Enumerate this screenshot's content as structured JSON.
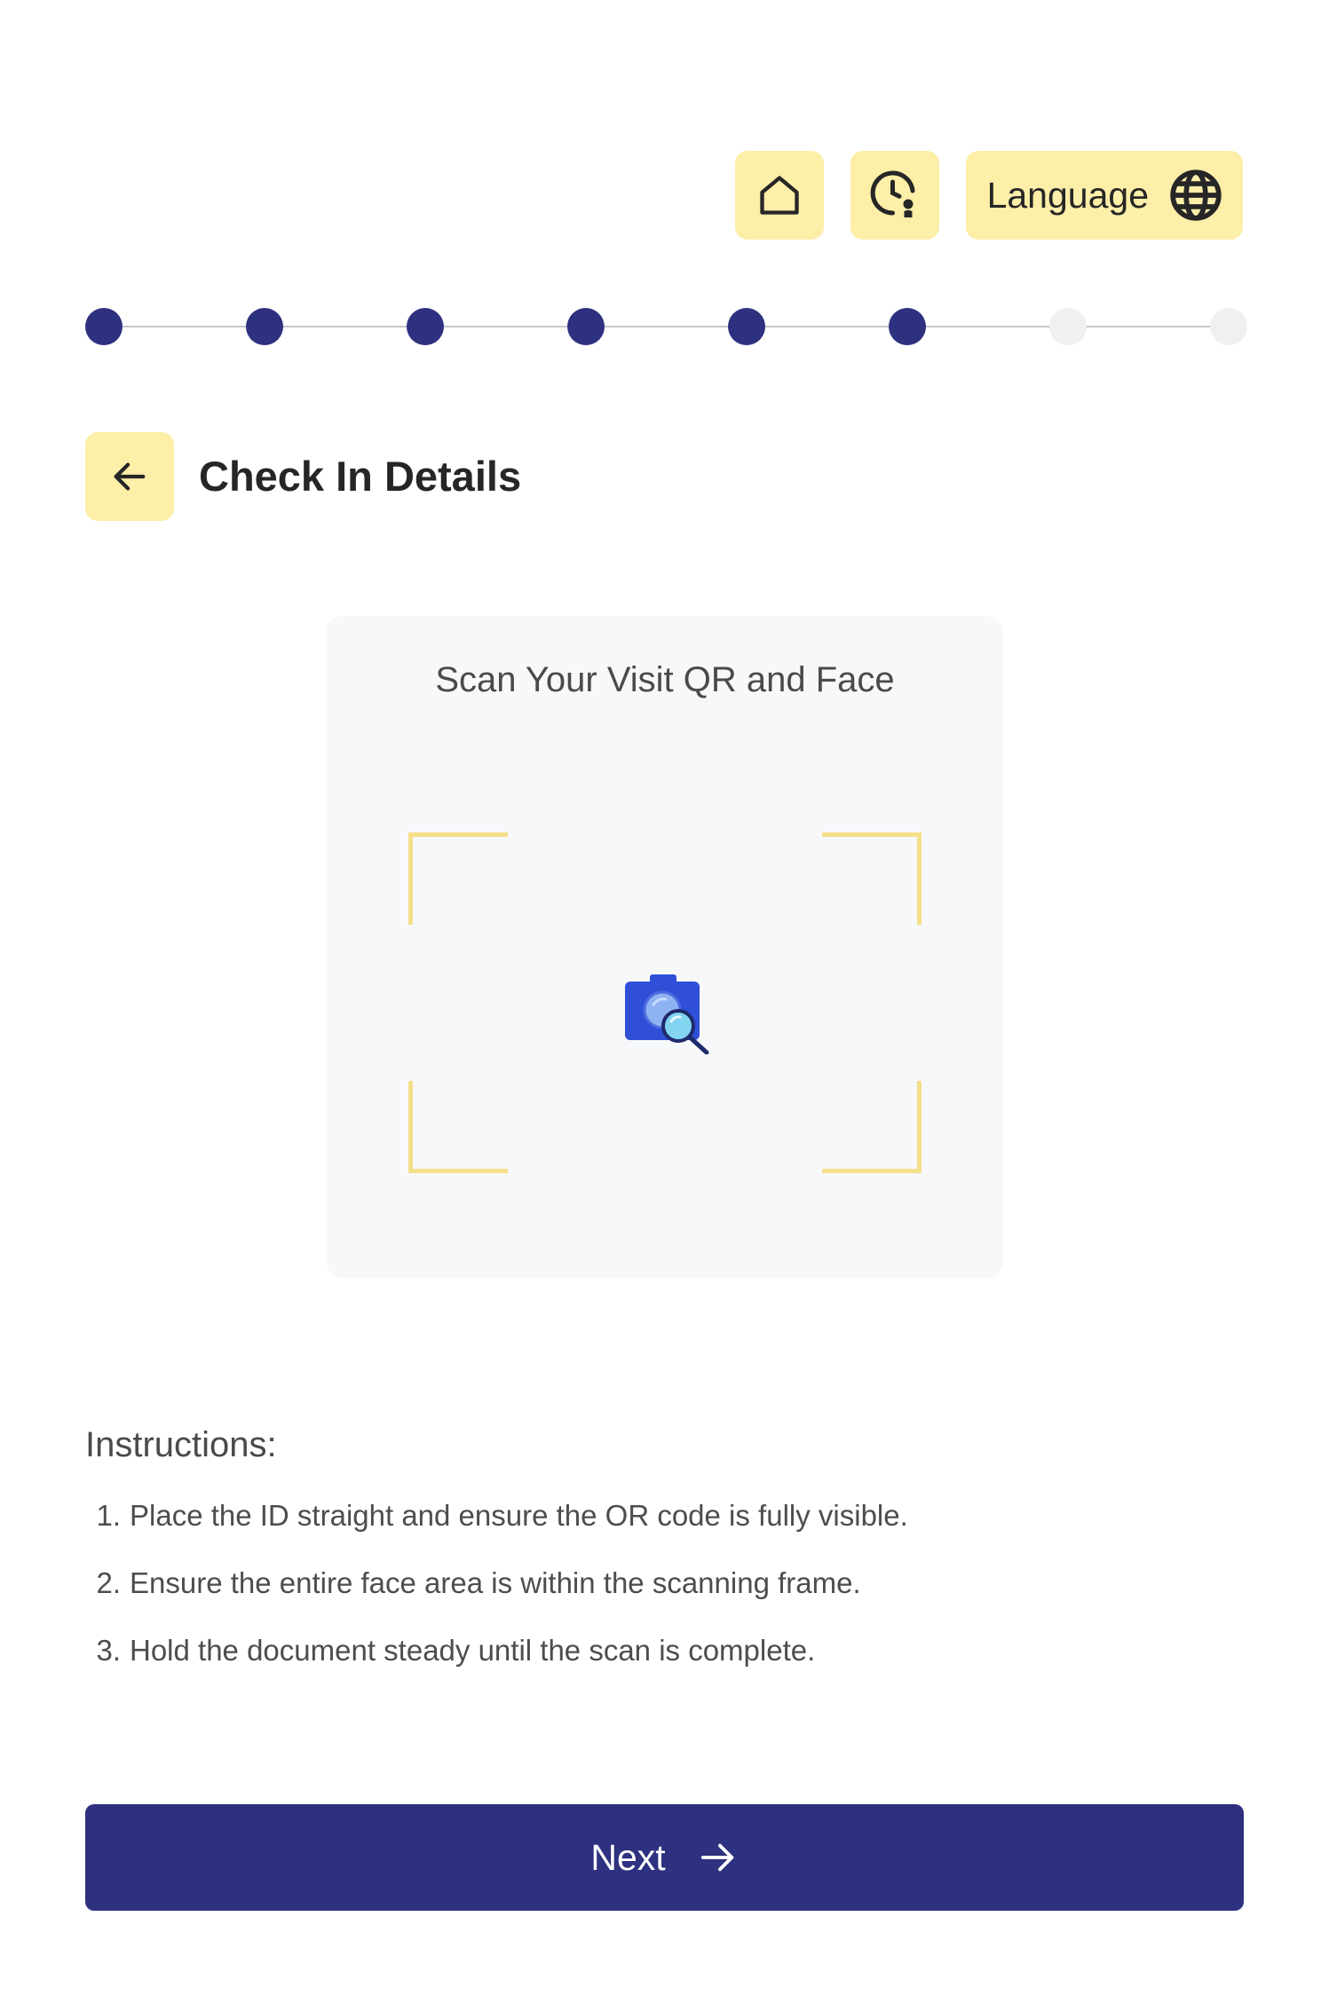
{
  "header": {
    "language_label": "Language"
  },
  "stepper": {
    "total_steps": 8,
    "completed_steps": 6
  },
  "page": {
    "title": "Check In Details"
  },
  "scan": {
    "title": "Scan Your Visit QR and Face"
  },
  "instructions": {
    "title": "Instructions:",
    "items": [
      {
        "num": "1.",
        "text": "Place the ID straight and ensure the OR code is fully visible."
      },
      {
        "num": "2.",
        "text": "Ensure the entire face area is within the scanning frame."
      },
      {
        "num": "3.",
        "text": "Hold the document steady until the scan is complete."
      }
    ]
  },
  "footer": {
    "next_label": "Next"
  },
  "icons": {
    "home": "home-icon",
    "history": "clock-badge-icon",
    "language": "globe-icon",
    "back": "arrow-left-icon",
    "camera": "camera-search-icon",
    "next": "arrow-right-icon"
  },
  "colors": {
    "accent_yellow": "#fdeea8",
    "primary_navy": "#2e3180",
    "frame_yellow": "#f5df8a",
    "step_inactive": "#f0f0f3"
  }
}
